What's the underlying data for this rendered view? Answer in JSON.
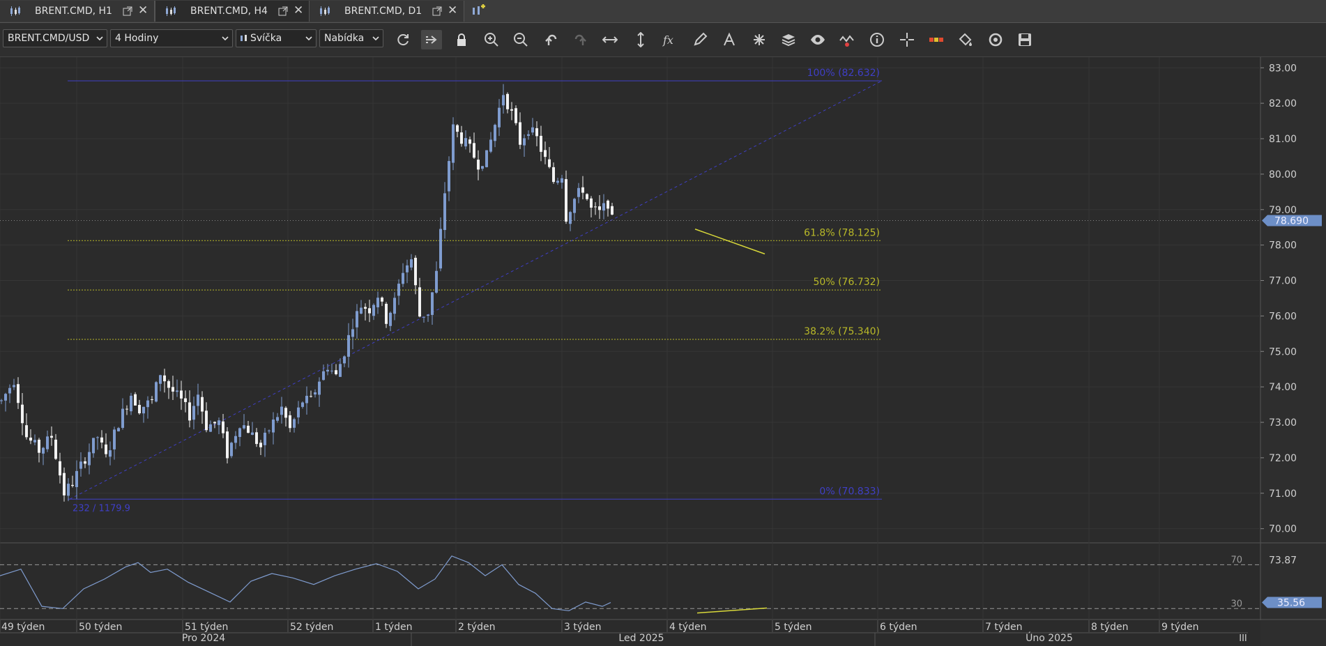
{
  "tabs": [
    {
      "label": "BRENT.CMD, H1",
      "active": false
    },
    {
      "label": "BRENT.CMD, H4",
      "active": true
    },
    {
      "label": "BRENT.CMD, D1",
      "active": false
    }
  ],
  "toolbar": {
    "symbol": "BRENT.CMD/USD",
    "timeframe": "4 Hodiny",
    "chart_type": "Svíčka",
    "price_side": "Nabídka",
    "icons": [
      "refresh-icon",
      "autoscroll-icon",
      "lock-icon",
      "zoom-in-icon",
      "zoom-out-icon",
      "undo-icon",
      "redo-icon",
      "horizontal-scale-icon",
      "vertical-scale-icon",
      "function-icon",
      "pencil-icon",
      "text-tool-icon",
      "objects-icon",
      "layers-icon",
      "eye-icon",
      "indicator-alert-icon",
      "info-icon",
      "crosshair-icon",
      "ruler-icon",
      "paint-bucket-icon",
      "reload-icon",
      "save-icon"
    ]
  },
  "colors": {
    "background": "#2b2b2b",
    "bull_candle": "#7f9ccf",
    "bear_candle": "#f2f2f2",
    "fib_blue": "#3f3fc6",
    "fib_yellow": "#b9b928",
    "trendline": "#d8d83a",
    "price_badge": "#6d8fc7"
  },
  "chart_data": {
    "type": "candlestick",
    "symbol": "BRENT.CMD/USD",
    "timeframe": "4 Hodiny",
    "ylim": [
      69.6,
      83.3
    ],
    "y_ticks": [
      "83.00",
      "82.00",
      "81.00",
      "80.00",
      "79.00",
      "78.00",
      "77.00",
      "76.00",
      "75.00",
      "74.00",
      "73.00",
      "72.00",
      "71.00",
      "70.00"
    ],
    "current_price": "78.690",
    "close_path": [
      [
        0,
        73.6
      ],
      [
        3,
        74.2
      ],
      [
        6,
        72.6
      ],
      [
        9,
        72.2
      ],
      [
        12,
        72.6
      ],
      [
        15,
        71.0
      ],
      [
        17,
        71.3
      ],
      [
        20,
        72.0
      ],
      [
        23,
        72.6
      ],
      [
        25,
        72.0
      ],
      [
        28,
        73.0
      ],
      [
        31,
        73.8
      ],
      [
        33,
        73.4
      ],
      [
        36,
        73.6
      ],
      [
        38,
        74.4
      ],
      [
        40,
        74.0
      ],
      [
        43,
        73.6
      ],
      [
        45,
        73.2
      ],
      [
        47,
        73.8
      ],
      [
        49,
        72.9
      ],
      [
        52,
        73.0
      ],
      [
        54,
        72.1
      ],
      [
        57,
        73.0
      ],
      [
        59,
        72.8
      ],
      [
        62,
        72.3
      ],
      [
        64,
        72.8
      ],
      [
        67,
        73.4
      ],
      [
        69,
        72.8
      ],
      [
        72,
        73.6
      ],
      [
        74,
        73.6
      ],
      [
        76,
        74.2
      ],
      [
        78,
        74.6
      ],
      [
        80,
        74.3
      ],
      [
        82,
        75.0
      ],
      [
        84,
        75.8
      ],
      [
        86,
        76.3
      ],
      [
        88,
        76.2
      ],
      [
        90,
        76.6
      ],
      [
        92,
        75.9
      ],
      [
        94,
        76.4
      ],
      [
        96,
        77.3
      ],
      [
        98,
        77.6
      ],
      [
        100,
        76.0
      ],
      [
        102,
        76.1
      ],
      [
        104,
        77.2
      ],
      [
        106,
        79.5
      ],
      [
        107,
        80.4
      ],
      [
        108,
        81.3
      ],
      [
        110,
        81.0
      ],
      [
        112,
        80.7
      ],
      [
        114,
        80.3
      ],
      [
        116,
        80.5
      ],
      [
        118,
        81.4
      ],
      [
        120,
        82.3
      ],
      [
        122,
        81.7
      ],
      [
        124,
        80.9
      ],
      [
        126,
        81.3
      ],
      [
        128,
        81.0
      ],
      [
        130,
        80.4
      ],
      [
        132,
        79.8
      ],
      [
        134,
        80.0
      ],
      [
        135,
        78.8
      ],
      [
        137,
        79.3
      ],
      [
        139,
        79.6
      ],
      [
        141,
        79.0
      ],
      [
        143,
        78.9
      ],
      [
        145,
        79.2
      ],
      [
        146,
        78.69
      ]
    ],
    "fibonacci": [
      {
        "label": "100% (82.632)",
        "value": 82.632,
        "color": "blue"
      },
      {
        "label": "61.8% (78.125)",
        "value": 78.125,
        "color": "yellow"
      },
      {
        "label": "50% (76.732)",
        "value": 76.732,
        "color": "yellow"
      },
      {
        "label": "38.2% (75.340)",
        "value": 75.34,
        "color": "yellow"
      },
      {
        "label": "0% (70.833)",
        "value": 70.833,
        "color": "blue"
      }
    ],
    "fib_anchor_label": "232 / 1179.9",
    "oscillator": {
      "levels": [
        {
          "label": "70",
          "value": 70
        },
        {
          "label": "30",
          "value": 30
        }
      ],
      "axis_label": "73.87",
      "current_value": "35.56",
      "ylim": [
        20,
        90
      ],
      "path": [
        [
          0,
          60
        ],
        [
          5,
          66
        ],
        [
          10,
          32
        ],
        [
          15,
          30
        ],
        [
          20,
          48
        ],
        [
          25,
          57
        ],
        [
          30,
          68
        ],
        [
          33,
          72
        ],
        [
          36,
          63
        ],
        [
          40,
          66
        ],
        [
          45,
          54
        ],
        [
          50,
          45
        ],
        [
          55,
          36
        ],
        [
          60,
          55
        ],
        [
          65,
          62
        ],
        [
          70,
          58
        ],
        [
          75,
          52
        ],
        [
          80,
          60
        ],
        [
          85,
          66
        ],
        [
          90,
          71
        ],
        [
          95,
          64
        ],
        [
          100,
          48
        ],
        [
          104,
          57
        ],
        [
          108,
          78
        ],
        [
          112,
          72
        ],
        [
          116,
          60
        ],
        [
          120,
          70
        ],
        [
          124,
          52
        ],
        [
          128,
          44
        ],
        [
          132,
          30
        ],
        [
          136,
          28
        ],
        [
          140,
          36
        ],
        [
          144,
          32
        ],
        [
          146,
          35.56
        ]
      ]
    },
    "x_week_labels": [
      "49 týden",
      "50 týden",
      "51 týden",
      "52 týden",
      "1 týden",
      "2 týden",
      "3 týden",
      "4 týden",
      "5 týden",
      "6 týden",
      "7 týden",
      "8 týden",
      "9 týden"
    ],
    "x_month_labels": [
      "Pro 2024",
      "Led 2025",
      "Úno 2025"
    ],
    "x_corner_label": "III"
  }
}
